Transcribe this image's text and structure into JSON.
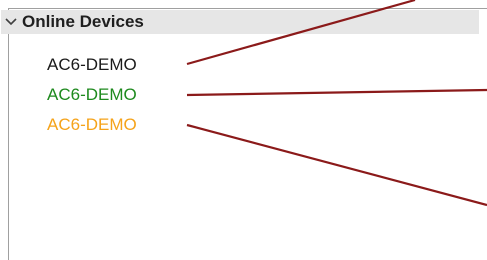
{
  "tree": {
    "group_label": "Online Devices",
    "expand_icon": "chevron-down-icon",
    "devices": [
      {
        "label": "AC6-DEMO",
        "color": "#1a1a1a"
      },
      {
        "label": "AC6-DEMO",
        "color": "#1e8a1e"
      },
      {
        "label": "AC6-DEMO",
        "color": "#f5a31a"
      }
    ]
  },
  "callout_color": "#8b1a1a"
}
